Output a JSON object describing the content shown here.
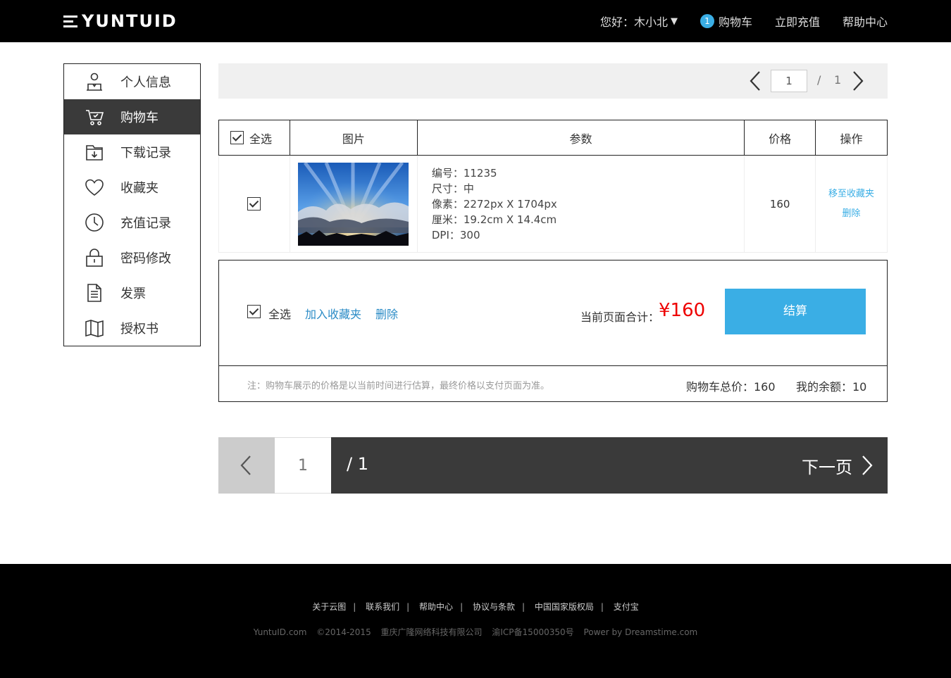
{
  "header": {
    "logo": "YUNTUID",
    "greeting": "您好：木小北",
    "greeting_caret": "▼",
    "cart_count": "1",
    "cart_label": "购物车",
    "recharge_label": "立即充值",
    "help_label": "帮助中心"
  },
  "sidebar": {
    "items": [
      {
        "label": "个人信息",
        "icon": "user-icon"
      },
      {
        "label": "购物车",
        "icon": "cart-icon"
      },
      {
        "label": "下载记录",
        "icon": "download-folder-icon"
      },
      {
        "label": "收藏夹",
        "icon": "heart-icon"
      },
      {
        "label": "充值记录",
        "icon": "clock-icon"
      },
      {
        "label": "密码修改",
        "icon": "lock-icon"
      },
      {
        "label": "发票",
        "icon": "document-icon"
      },
      {
        "label": "授权书",
        "icon": "map-icon"
      }
    ],
    "active_index": 1
  },
  "pager_top": {
    "current": "1",
    "separator": "/",
    "total": "1"
  },
  "table": {
    "headers": {
      "select_all": "全选",
      "image": "图片",
      "params": "参数",
      "price": "价格",
      "action": "操作"
    },
    "rows": [
      {
        "checked": true,
        "image": "sky-sunrays-photo",
        "params": [
          "编号：11235",
          "尺寸：中",
          "像素：2272px X 1704px",
          "厘米：19.2cm X 14.4cm",
          "DPI：300"
        ],
        "price": "160",
        "actions": [
          "移至收藏夹",
          "删除"
        ]
      }
    ]
  },
  "summary": {
    "select_all": "全选",
    "add_favorite": "加入收藏夹",
    "delete": "删除",
    "page_total_label": "当前页面合计：",
    "page_total_amount": "¥160",
    "checkout": "结算",
    "note": "注：购物车展示的价格是以当前时间进行估算，最终价格以支付页面为准。",
    "cart_total": "购物车总价：160",
    "balance": "我的余额：10"
  },
  "pager_bottom": {
    "current": "1",
    "total": "/ 1",
    "next": "下一页"
  },
  "footer": {
    "links": [
      "关于云图",
      "联系我们",
      "帮助中心",
      "协议与条款",
      "中国国家版权局",
      "支付宝"
    ],
    "link_separator": "|",
    "copyright": [
      "YuntuID.com",
      "©2014-2015",
      "重庆广隆网络科技有限公司",
      "渝ICP备15000350号",
      "Power by Dreamstime.com"
    ]
  },
  "colors": {
    "accent": "#3aaee5",
    "price_red": "#ee0000",
    "header_bg": "#000000",
    "dark_panel": "#3a3a3a"
  }
}
